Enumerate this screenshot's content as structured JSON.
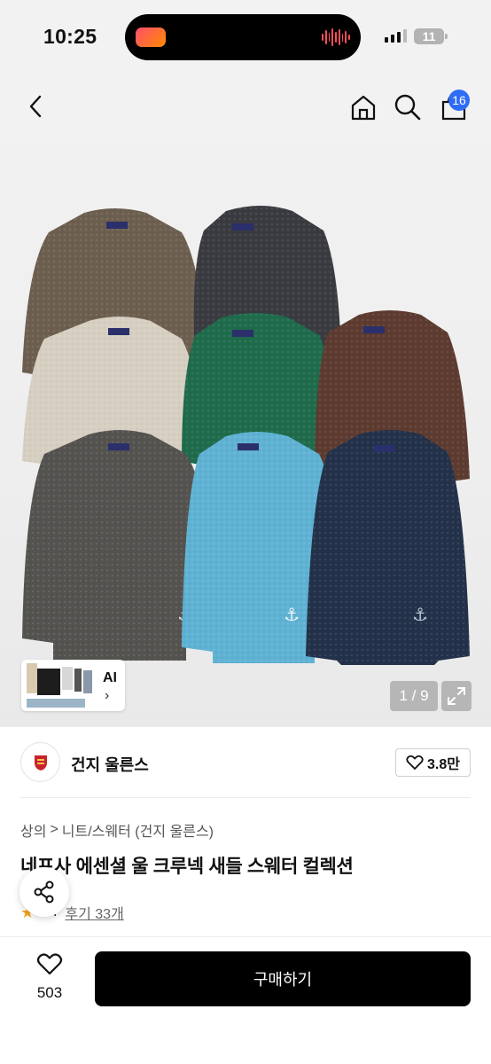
{
  "status_bar": {
    "time": "10:25",
    "battery": "11"
  },
  "nav": {
    "back_icon": "chevron-left-icon",
    "home_icon": "home-icon",
    "search_icon": "search-icon",
    "cart_icon": "shopping-bag-icon",
    "cart_count": "16"
  },
  "gallery": {
    "ai_label": "AI",
    "ai_chevron": "›",
    "counter": "1 / 9",
    "expand_icon": "expand-icon"
  },
  "brand": {
    "name": "건지 울른스",
    "like_count": "3.8만"
  },
  "breadcrumb": {
    "items": [
      "상의",
      "니트/스웨터 (건지 울른스)"
    ],
    "separator": ">"
  },
  "product": {
    "title": "네프사 에센셜 울 크루넥 새들 스웨터 컬렉션",
    "rating": "4.7",
    "reviews": "후기 33개"
  },
  "bottom": {
    "wish_count": "503",
    "buy_label": "구매하기"
  },
  "colors": {
    "accent_blue": "#2f6cf5",
    "button_black": "#000000",
    "star": "#f5a623"
  }
}
